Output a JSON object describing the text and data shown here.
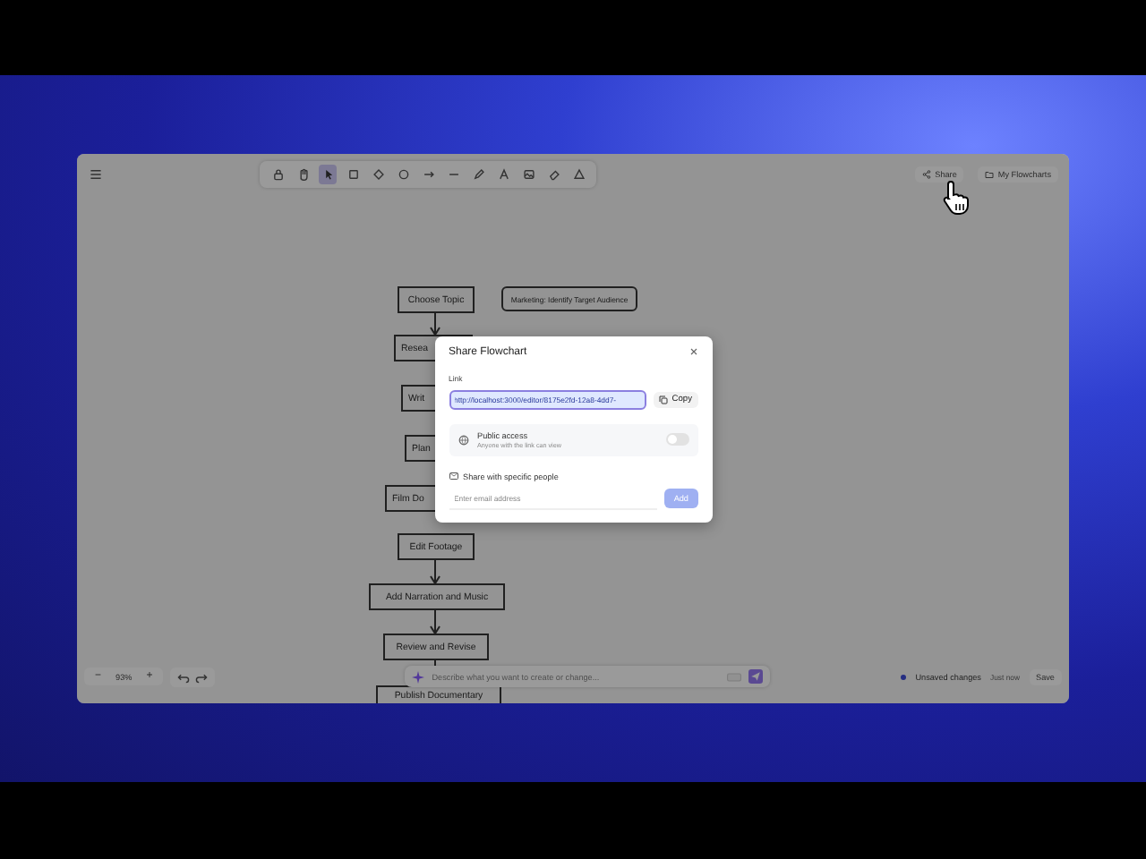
{
  "toolbar": {
    "tools": [
      {
        "kind": "lock",
        "selected": false
      },
      {
        "kind": "hand",
        "selected": false
      },
      {
        "kind": "pointer",
        "selected": true
      },
      {
        "kind": "rectangle",
        "selected": false
      },
      {
        "kind": "diamond",
        "selected": false
      },
      {
        "kind": "circle",
        "selected": false
      },
      {
        "kind": "arrow",
        "selected": false
      },
      {
        "kind": "line",
        "selected": false
      },
      {
        "kind": "pen",
        "selected": false
      },
      {
        "kind": "text",
        "selected": false
      },
      {
        "kind": "image",
        "selected": false
      },
      {
        "kind": "eraser",
        "selected": false
      },
      {
        "kind": "shapes",
        "selected": false
      }
    ]
  },
  "header_actions": [
    "Share",
    "My Flowcharts"
  ],
  "canvas": {
    "nodes": [
      "Choose Topic",
      "Marketing: Identify Target Audience",
      "Resea",
      "Writ",
      "Plan",
      "Film Do",
      "Edit Footage",
      "Add Narration and Music",
      "Review and Revise",
      "Publish Documentary"
    ]
  },
  "dialog": {
    "title": "Share Flowchart",
    "link_label": "Link",
    "link_value": "http://localhost:3000/editor/8175e2fd-12a8-4dd7-",
    "copy_button": "Copy",
    "public_access": {
      "title": "Public access",
      "subtitle": "Anyone with the link can view",
      "on": false
    },
    "people_label": "Share with specific people",
    "email_placeholder": "Enter email address",
    "add_button": "Add"
  },
  "bottom_bar": {
    "zoom_out": "−",
    "zoom": "93%",
    "zoom_in": "+",
    "prompt_placeholder": "Describe what you want to create or change...",
    "status": "Unsaved changes",
    "saved_time": "Just now",
    "save_button": "Save"
  }
}
